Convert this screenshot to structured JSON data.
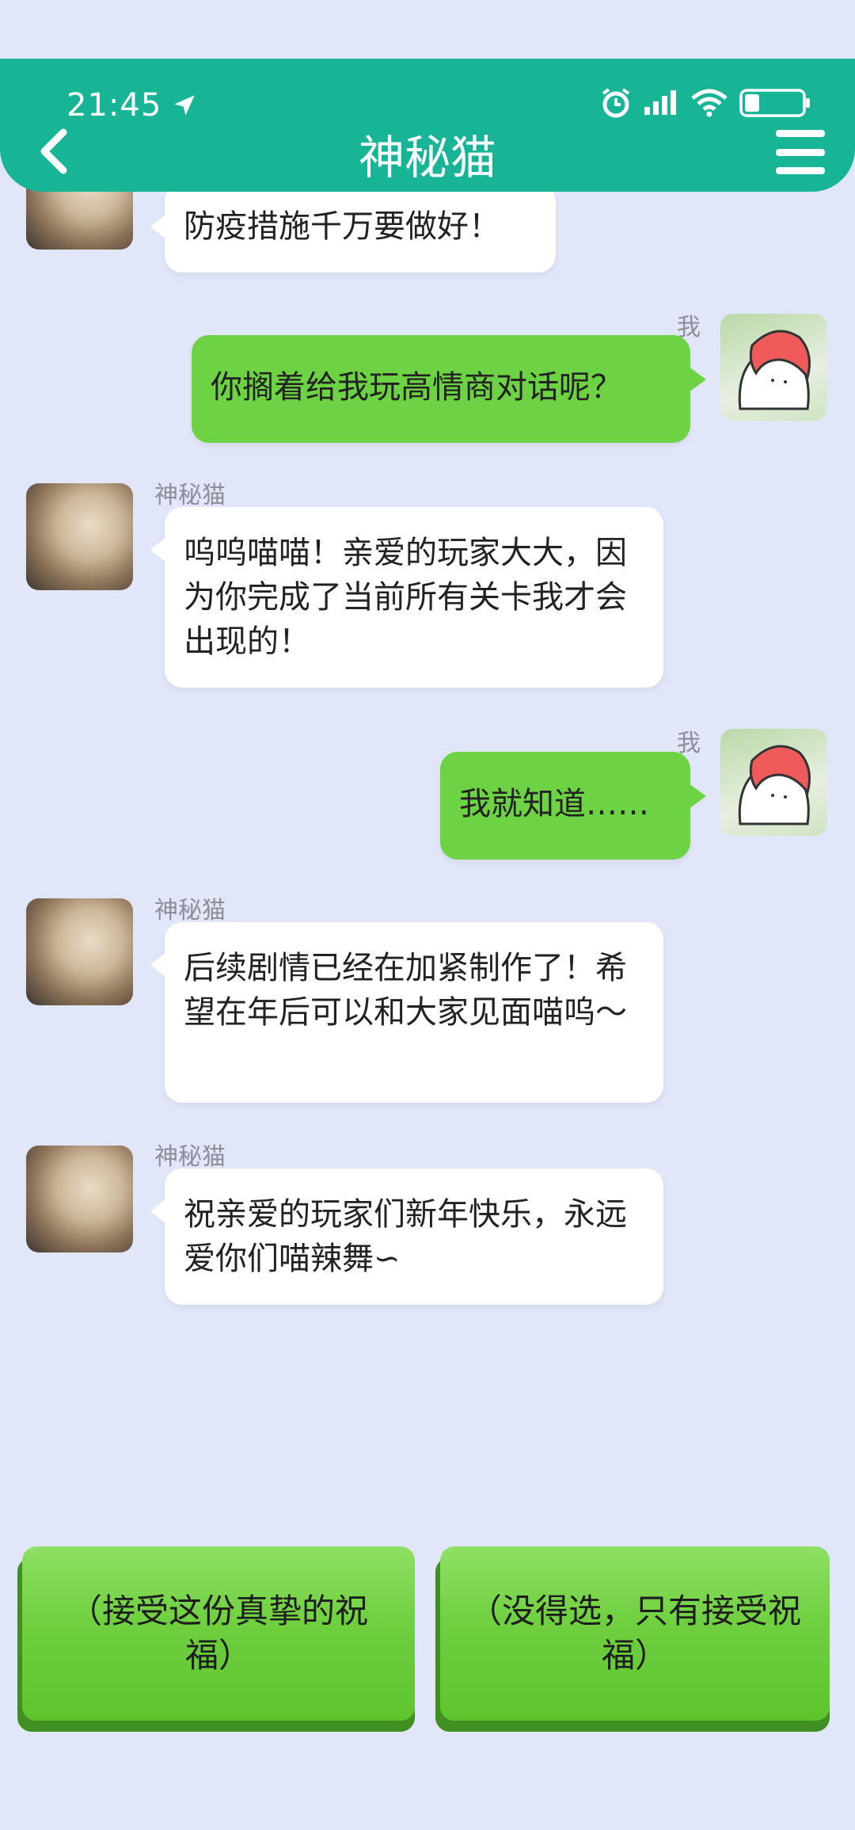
{
  "status_bar": {
    "time": "21:45"
  },
  "header": {
    "title": "神秘猫",
    "back_icon": "chevron-left-icon",
    "menu_icon": "hamburger-menu-icon"
  },
  "colors": {
    "header_bg": "#18b496",
    "page_bg": "#e1e7f8",
    "my_bubble": "#6dd244",
    "their_bubble": "#ffffff",
    "choice_button": "#6fcf3f"
  },
  "messages": [
    {
      "from": "other",
      "sender": "",
      "text": "防疫措施千万要做好！"
    },
    {
      "from": "me",
      "sender": "我",
      "text": "你搁着给我玩高情商对话呢？"
    },
    {
      "from": "other",
      "sender": "神秘猫",
      "text": "呜呜喵喵！亲爱的玩家大大，因为你完成了当前所有关卡我才会出现的！"
    },
    {
      "from": "me",
      "sender": "我",
      "text": "我就知道……"
    },
    {
      "from": "other",
      "sender": "神秘猫",
      "text": "后续剧情已经在加紧制作了！希望在年后可以和大家见面喵呜～"
    },
    {
      "from": "other",
      "sender": "神秘猫",
      "text": "祝亲爱的玩家们新年快乐，永远爱你们喵辣舞∽"
    }
  ],
  "choices": [
    {
      "label": "（接受这份真挚的祝福）"
    },
    {
      "label": "（没得选，只有接受祝福）"
    }
  ]
}
